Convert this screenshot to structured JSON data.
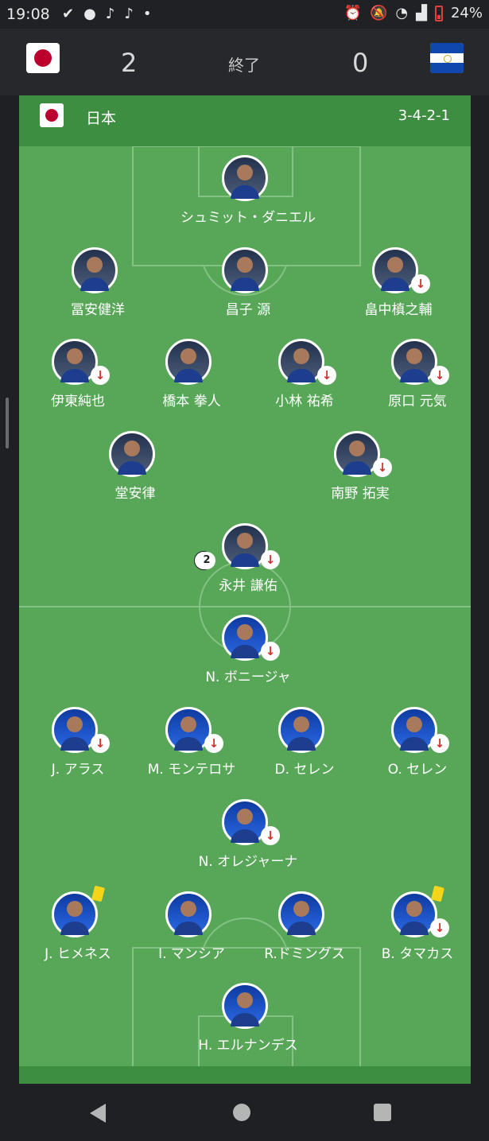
{
  "status_bar": {
    "time": "19:08",
    "battery": "24%",
    "left_icons": [
      "check-icon",
      "circle-icon",
      "notification-icon",
      "notification-icon",
      "dot-icon"
    ],
    "right_icons": [
      "alarm-icon",
      "mute-icon",
      "wifi-icon",
      "signal-icon",
      "battery-icon"
    ]
  },
  "match": {
    "home_score": "2",
    "status": "終了",
    "away_score": "0"
  },
  "team": {
    "name": "日本",
    "formation": "3-4-2-1"
  },
  "colors": {
    "pitch": "#58a758",
    "team_bar": "#3e8e41",
    "sub_arrow": "#d32f2f",
    "yellow_card": "#f5d51a"
  },
  "home_players": [
    {
      "name": "シュミット・ダニエル",
      "sub": false
    },
    {
      "name": "冨安健洋",
      "sub": false
    },
    {
      "name": "昌子 源",
      "sub": false
    },
    {
      "name": "畠中槙之輔",
      "sub": true
    },
    {
      "name": "伊東純也",
      "sub": true
    },
    {
      "name": "橋本 拳人",
      "sub": false
    },
    {
      "name": "小林 祐希",
      "sub": true
    },
    {
      "name": "原口 元気",
      "sub": true
    },
    {
      "name": "堂安律",
      "sub": false
    },
    {
      "name": "南野 拓実",
      "sub": true
    },
    {
      "name": "永井 謙佑",
      "sub": true,
      "goals": "2"
    }
  ],
  "away_players": [
    {
      "name": "N. ボニージャ",
      "sub": true
    },
    {
      "name": "J. アラス",
      "sub": true
    },
    {
      "name": "M. モンテロサ",
      "sub": true
    },
    {
      "name": "D. セレン",
      "sub": false
    },
    {
      "name": "O. セレン",
      "sub": true
    },
    {
      "name": "N. オレジャーナ",
      "sub": true
    },
    {
      "name": "J. ヒメネス",
      "sub": false,
      "yellow_card": true
    },
    {
      "name": "I. マンシア",
      "sub": false
    },
    {
      "name": "R.ドミングス",
      "sub": false
    },
    {
      "name": "B. タマカス",
      "sub": true,
      "yellow_card": true
    },
    {
      "name": "H. エルナンデス",
      "sub": false
    }
  ],
  "nav": {
    "icons": [
      "back-icon",
      "home-icon",
      "recents-icon"
    ]
  }
}
